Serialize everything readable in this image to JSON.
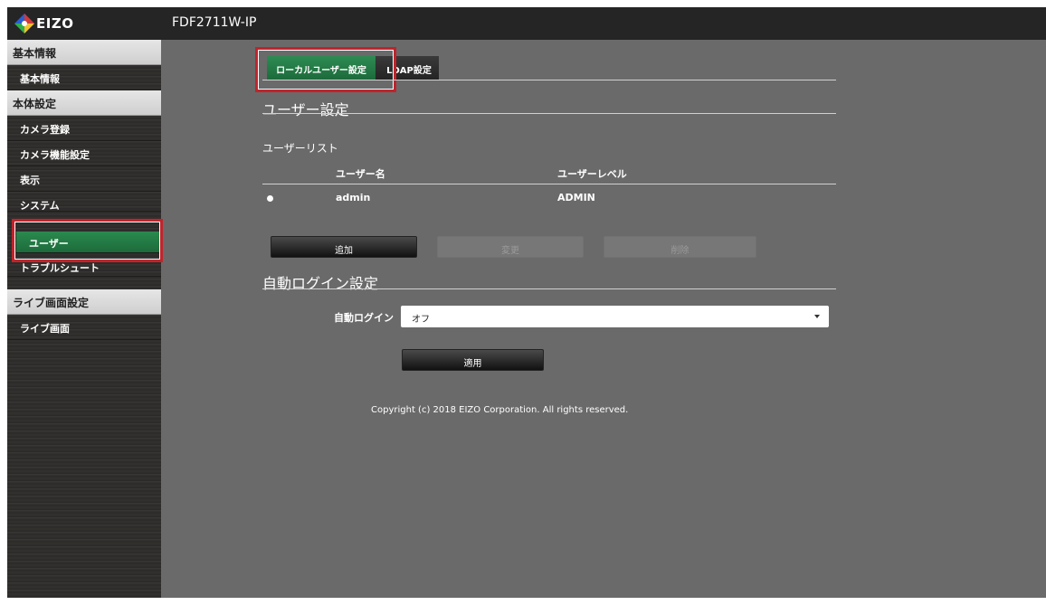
{
  "header": {
    "logo_text": "EIZO",
    "app_title": "FDF2711W-IP"
  },
  "sidebar": {
    "sections": [
      {
        "label": "基本情報",
        "items": [
          "基本情報"
        ]
      },
      {
        "label": "本体設定",
        "items": [
          "カメラ登録",
          "カメラ機能設定",
          "表示",
          "システム",
          "ユーザー",
          "トラブルシュート"
        ]
      },
      {
        "label": "ライブ画面設定",
        "items": [
          "ライブ画面"
        ]
      }
    ],
    "active_item": "ユーザー"
  },
  "tabs": [
    {
      "label": "ローカルユーザー設定",
      "active": true
    },
    {
      "label": "LDAP設定",
      "active": false
    }
  ],
  "user_settings": {
    "title": "ユーザー設定",
    "list_title": "ユーザーリスト",
    "columns": [
      "ユーザー名",
      "ユーザーレベル"
    ],
    "rows": [
      {
        "username": "admin",
        "level": "ADMIN",
        "selected": true
      }
    ],
    "buttons": {
      "add": "追加",
      "change": "変更",
      "delete": "削除"
    }
  },
  "auto_login": {
    "title": "自動ログイン設定",
    "label": "自動ログイン",
    "value": "オフ",
    "apply": "適用"
  },
  "footer": {
    "copyright": "Copyright (c) 2018 EIZO Corporation. All rights reserved."
  },
  "colors": {
    "accent_green": "#1d6b3b",
    "highlight_red": "#c0242c",
    "background": "#6a6a6a"
  }
}
